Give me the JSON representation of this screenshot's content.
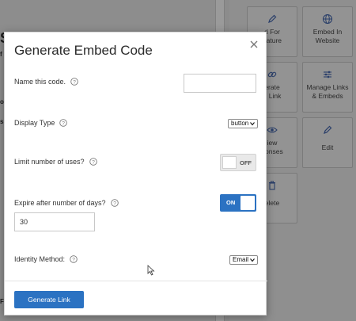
{
  "background": {
    "left_fragments": [
      "S",
      "f",
      "o",
      "s",
      "F"
    ],
    "tiles": [
      {
        "label": "d For\nnature",
        "icon": "pen-icon"
      },
      {
        "label": "Embed In\nWebsite",
        "icon": "globe-icon"
      },
      {
        "label": "erate\ne Link",
        "icon": "link-icon"
      },
      {
        "label": "Manage Links\n& Embeds",
        "icon": "sliders-icon"
      },
      {
        "label": "iew\nponses",
        "icon": "eye-icon"
      },
      {
        "label": "Edit",
        "icon": "pencil-icon"
      },
      {
        "label": "elete",
        "icon": "trash-icon"
      }
    ]
  },
  "modal": {
    "title": "Generate Embed Code",
    "fields": {
      "name": {
        "label": "Name this code.",
        "value": ""
      },
      "display_type": {
        "label": "Display Type",
        "value": "button"
      },
      "limit_uses": {
        "label": "Limit number of uses?",
        "state": "OFF"
      },
      "expire": {
        "label": "Expire after number of days?",
        "state": "ON",
        "days": "30"
      },
      "identity": {
        "label": "Identity Method:",
        "value": "Email"
      }
    },
    "submit_label": "Generate Link"
  },
  "colors": {
    "accent": "#2b72c2",
    "toggle_off_bg": "#e9e9e9"
  }
}
